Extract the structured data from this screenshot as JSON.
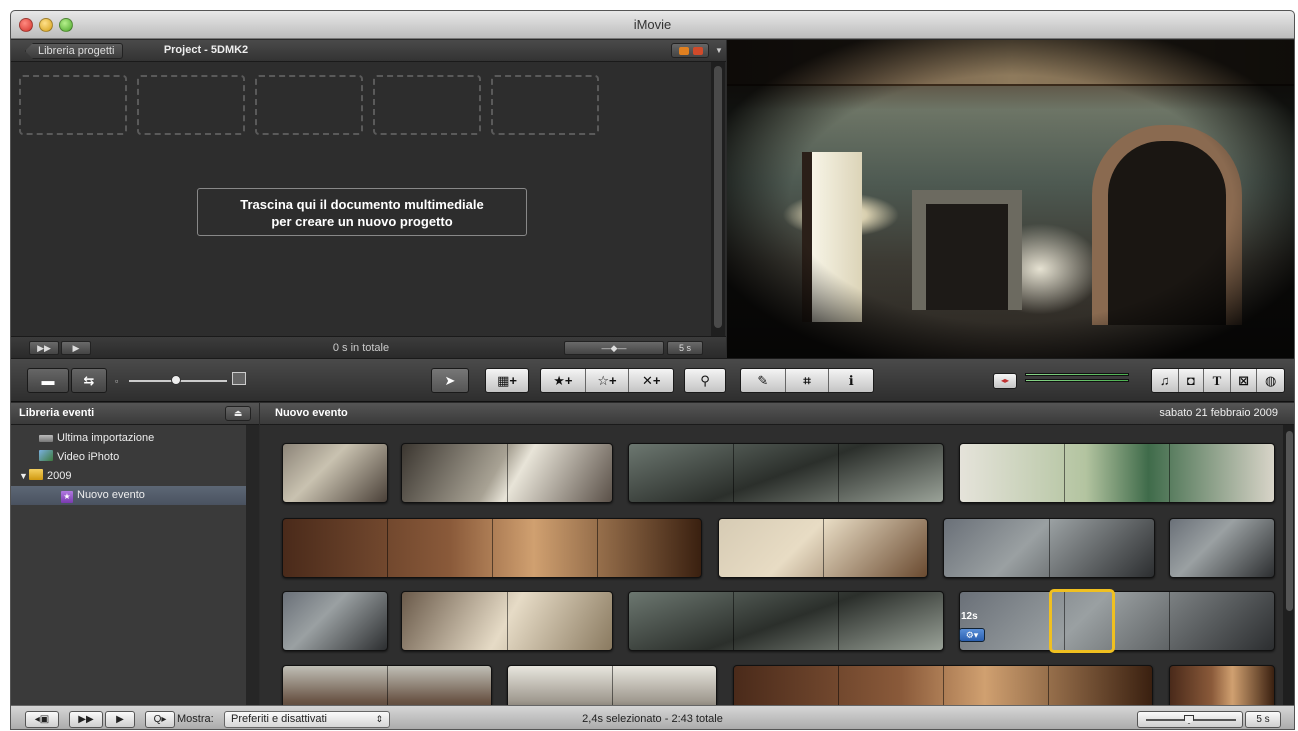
{
  "app": {
    "title": "iMovie"
  },
  "project": {
    "back_label": "Libreria progetti",
    "title": "Project - 5DMK2",
    "drop_message_line1": "Trascina qui il documento multimediale",
    "drop_message_line2": "per creare un nuovo progetto",
    "total": "0 s in totale",
    "thumb_duration": "5 s"
  },
  "event_library": {
    "title": "Libreria eventi",
    "items": [
      {
        "label": "Ultima importazione",
        "icon": "film-icon"
      },
      {
        "label": "Video iPhoto",
        "icon": "iphoto-icon"
      },
      {
        "label": "2009",
        "icon": "folder-icon"
      },
      {
        "label": "Nuovo evento",
        "icon": "star-event-icon",
        "selected": true
      }
    ]
  },
  "browser": {
    "event_name": "Nuovo evento",
    "event_date": "sabato 21 febbraio 2009",
    "clip_duration_badge": "12s",
    "selection_color": "#f0c020"
  },
  "toolbar": {
    "add_star": "★+",
    "add_empty_star": "☆+",
    "reject": "✕+"
  },
  "bottombar": {
    "show_label": "Mostra:",
    "filter_value": "Preferiti e disattivati",
    "status": "2,4s selezionato - 2:43 totale",
    "thumb_duration": "5 s"
  }
}
